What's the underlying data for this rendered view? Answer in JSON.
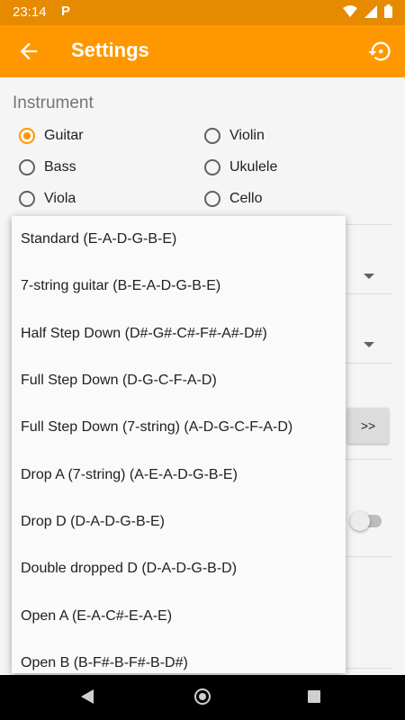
{
  "status_bar": {
    "time": "23:14",
    "notification_icon": "P",
    "icons": [
      "wifi-icon",
      "signal-icon",
      "battery-icon"
    ]
  },
  "app_bar": {
    "title": "Settings",
    "back_icon": "arrow-back-icon",
    "action_icon": "restore-icon"
  },
  "instrument": {
    "section_title": "Instrument",
    "options": [
      {
        "label": "Guitar",
        "selected": true
      },
      {
        "label": "Violin",
        "selected": false
      },
      {
        "label": "Bass",
        "selected": false
      },
      {
        "label": "Ukulele",
        "selected": false
      },
      {
        "label": "Viola",
        "selected": false
      },
      {
        "label": "Cello",
        "selected": false
      }
    ]
  },
  "background": {
    "next_button_label": ">>"
  },
  "tuning_dropdown": {
    "items": [
      "Standard (E-A-D-G-B-E)",
      "7-string guitar (B-E-A-D-G-B-E)",
      "Half Step Down (D#-G#-C#-F#-A#-D#)",
      "Full Step Down (D-G-C-F-A-D)",
      "Full Step Down (7-string) (A-D-G-C-F-A-D)",
      "Drop A (7-string) (A-E-A-D-G-B-E)",
      "Drop D (D-A-D-G-B-E)",
      "Double dropped D (D-A-D-G-B-D)",
      "Open A (E-A-C#-E-A-E)",
      "Open B (B-F#-B-F#-B-D#)"
    ]
  },
  "colors": {
    "accent": "#ff9800",
    "status_bar": "#e68a00"
  }
}
